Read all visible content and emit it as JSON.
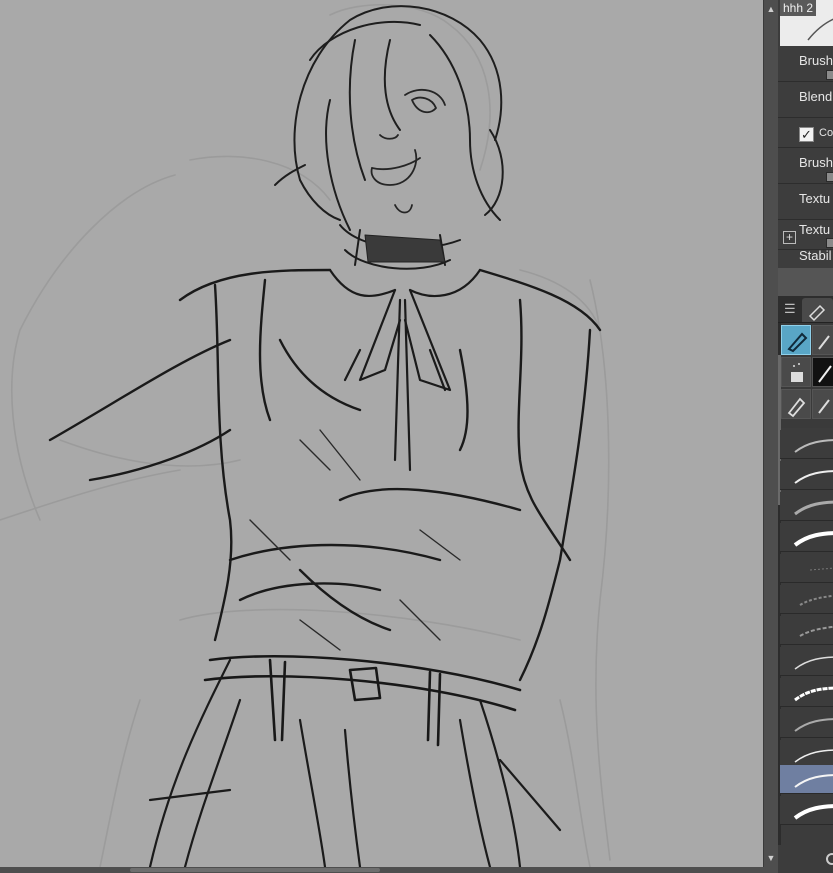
{
  "sub_tool": {
    "name": "hhh 2"
  },
  "properties": {
    "items": [
      {
        "label": "Brush"
      },
      {
        "label": "Blend"
      },
      {
        "label": "Co",
        "checked": true
      },
      {
        "label": "Brush"
      },
      {
        "label": "Textu"
      },
      {
        "label": "Textu"
      },
      {
        "label": "Stabil"
      }
    ]
  },
  "icons": {
    "panel_menu": "☰",
    "scroll_up": "▲",
    "scroll_down": "▼",
    "checkmark": "✓",
    "expand": "+"
  },
  "colors": {
    "canvas": "#a9a9a9",
    "panel": "#3c3c3c",
    "selected_tool": "#59a6c6",
    "selected_brush": "#6f7fa1"
  }
}
